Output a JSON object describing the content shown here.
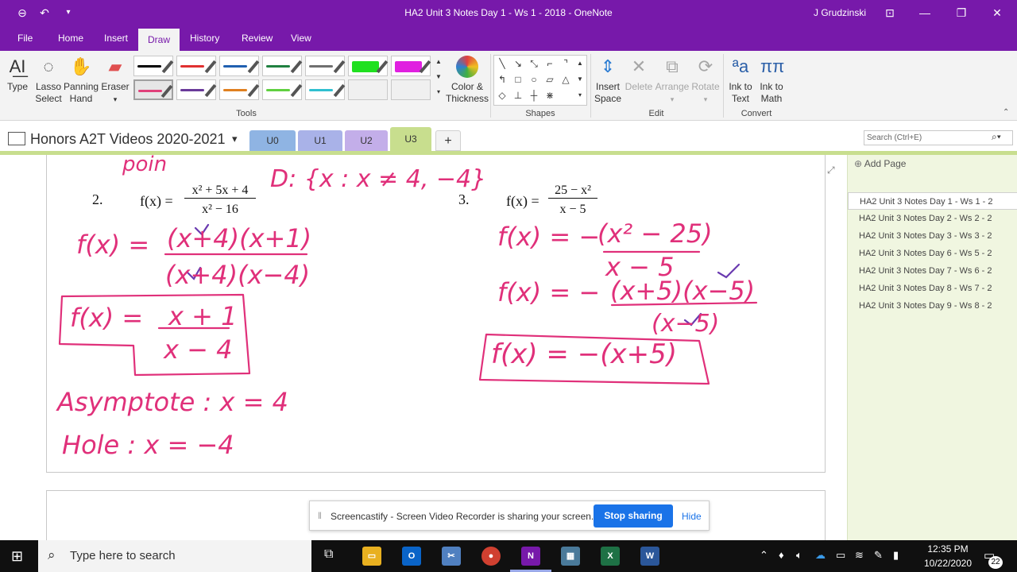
{
  "window": {
    "title": "HA2 Unit 3 Notes Day 1 - Ws 1 - 2018  -  OneNote",
    "user": "J Grudzinski"
  },
  "menu": {
    "tabs": [
      "File",
      "Home",
      "Insert",
      "Draw",
      "History",
      "Review",
      "View"
    ],
    "active": "Draw"
  },
  "ribbon": {
    "tools": {
      "type": "Type",
      "lasso1": "Lasso",
      "lasso2": "Select",
      "pan1": "Panning",
      "pan2": "Hand",
      "eraser": "Eraser",
      "color1": "Color &",
      "color2": "Thickness",
      "label": "Tools"
    },
    "pens_row1": [
      "#000000",
      "#E03030",
      "#2060B0",
      "#208040",
      "#707070",
      "#20E020",
      "#E020E0"
    ],
    "pens_row2": [
      "#E0407A",
      "#6A3A9A",
      "#E08020",
      "#60D040",
      "#30C0D0"
    ],
    "shapes_label": "Shapes",
    "edit": {
      "insert1": "Insert",
      "insert2": "Space",
      "delete": "Delete",
      "arrange": "Arrange",
      "rotate": "Rotate",
      "label": "Edit"
    },
    "convert": {
      "ink1": "Ink to",
      "ink2": "Text",
      "math1": "Ink to",
      "math2": "Math",
      "label": "Convert"
    }
  },
  "notebook": {
    "name": "Honors A2T Videos 2020-2021",
    "sections": [
      "U0",
      "U1",
      "U2",
      "U3"
    ],
    "active_section": "U3",
    "add_section": "+"
  },
  "search": {
    "placeholder": "Search (Ctrl+E)"
  },
  "pages": {
    "add_label": "Add Page",
    "items": [
      "HA2 Unit 3 Notes Day 1 - Ws 1 - 2",
      "HA2 Unit 3 Notes Day 2 - Ws 2 - 2",
      "HA2 Unit 3 Notes Day 3 - Ws 3 - 2",
      "HA2 Unit 3 Notes Day 6 - Ws 5 - 2",
      "HA2 Unit 3 Notes Day 7 - Ws 6 - 2",
      "HA2 Unit 3 Notes Day 8 - Ws 7 - 2",
      "HA2 Unit 3 Notes Day 9 - Ws 8 - 2"
    ],
    "selected": 0
  },
  "content": {
    "p2_num": "2.",
    "p2_fx": "f(x) =",
    "p2_num_expr": "x² + 5x + 4",
    "p2_den_expr": "x² − 16",
    "p3_num": "3.",
    "p3_fx": "f(x) =",
    "p3_num_expr": "25 − x²",
    "p3_den_expr": "x − 5",
    "ink": {
      "top": "poin",
      "domain": "D: {x : x ≠ 4, −4}",
      "p2_line1_lhs": "f(x) =",
      "p2_line1_num": "(x+4)(x+1)",
      "p2_line1_den": "(x+4)(x−4)",
      "p2_box_lhs": "f(x) =",
      "p2_box_num": "x + 1",
      "p2_box_den": "x − 4",
      "asymptote": "Asymptote : x = 4",
      "hole": "Hole : x = −4",
      "p3_line1_lhs": "f(x) = −",
      "p3_line1_num": "(x² − 25)",
      "p3_line1_den": "x − 5",
      "p3_line2_lhs": "f(x) = −",
      "p3_line2_num": "(x+5)(x−5)",
      "p3_line2_den": "(x−5)",
      "p3_box": "f(x) = −(x+5)"
    },
    "ink_color": "#E0307A",
    "check_color": "#6A3AB0"
  },
  "sharebar": {
    "message": "Screencastify - Screen Video Recorder is sharing your screen.",
    "stop": "Stop sharing",
    "hide": "Hide"
  },
  "taskbar": {
    "search_placeholder": "Type here to search",
    "time": "12:35 PM",
    "date": "10/22/2020",
    "notifications": "22"
  }
}
